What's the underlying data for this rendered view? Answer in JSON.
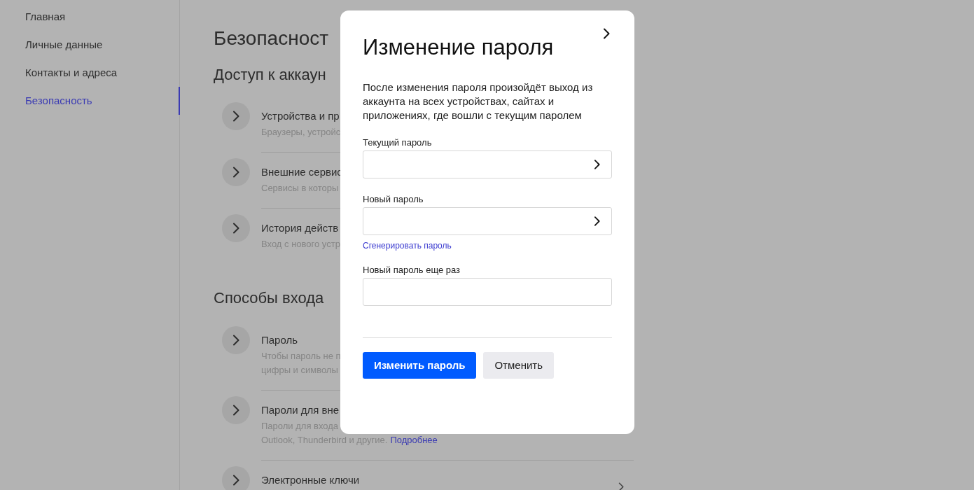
{
  "sidebar": {
    "items": [
      {
        "label": "Главная",
        "selected": false
      },
      {
        "label": "Личные данные",
        "selected": false
      },
      {
        "label": "Контакты и адреса",
        "selected": false
      },
      {
        "label": "Безопасность",
        "selected": true
      }
    ]
  },
  "main": {
    "title": "Безопасност",
    "sections": [
      {
        "heading": "Доступ к аккаун",
        "items": [
          {
            "title": "Устройства и пр",
            "lines": [
              {
                "text": "Браузеры, устройс"
              }
            ]
          },
          {
            "title": "Внешние сервис",
            "lines": [
              {
                "text": "Сервисы в которы"
              }
            ]
          },
          {
            "title": "История действ",
            "lines": [
              {
                "text": "Вход с нового устр"
              }
            ]
          }
        ]
      },
      {
        "heading": "Способы входа",
        "items": [
          {
            "title": "Пароль",
            "lines": [
              {
                "text": "Чтобы пароль не п"
              },
              {
                "text": "цифры и символы"
              }
            ]
          },
          {
            "title": "Пароли для вне",
            "lines": [
              {
                "text": "Пароли для входа"
              },
              {
                "text": "Outlook, Thunderbird и другие.",
                "link": "Подробнее"
              }
            ]
          },
          {
            "title": "Электронные ключи",
            "arrow": true
          }
        ]
      }
    ]
  },
  "dialog": {
    "title": "Изменение пароля",
    "description": "После изменения пароля произойдёт выход из аккаунта на всех устройствах, сайтах и приложениях, где вошли с текущим паролем",
    "fields": [
      {
        "label": "Текущий пароль",
        "trailing_icon": true
      },
      {
        "label": "Новый пароль",
        "trailing_icon": true,
        "link": "Сгенерировать пароль"
      },
      {
        "label": "Новый пароль еще раз",
        "trailing_icon": false
      }
    ],
    "buttons": [
      {
        "label": "Изменить пароль",
        "kind": "primary"
      },
      {
        "label": "Отменить",
        "kind": "secondary"
      }
    ]
  }
}
